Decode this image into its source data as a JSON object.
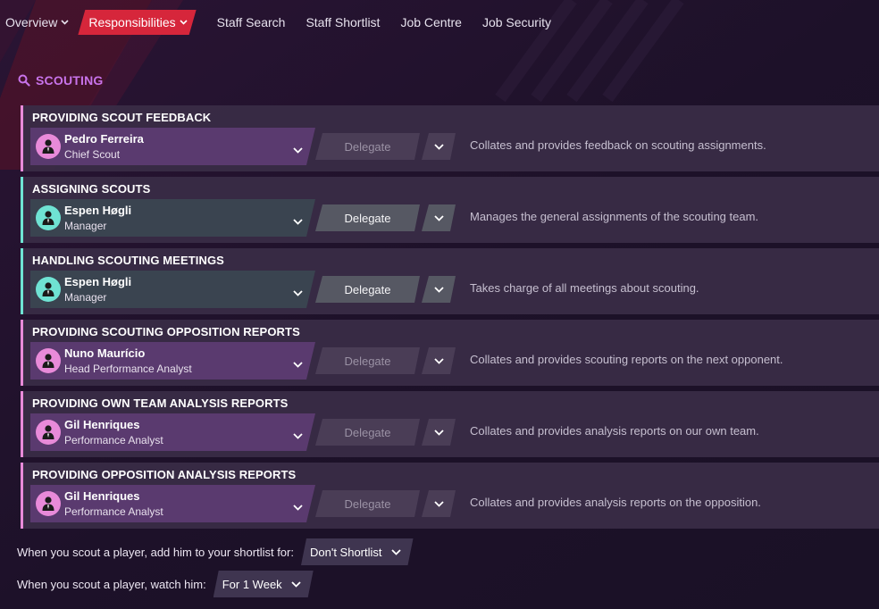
{
  "nav": {
    "items": [
      {
        "label": "Overview",
        "has_dropdown": true,
        "active": false
      },
      {
        "label": "Responsibilities",
        "has_dropdown": true,
        "active": true
      },
      {
        "label": "Staff Search",
        "has_dropdown": false,
        "active": false
      },
      {
        "label": "Staff Shortlist",
        "has_dropdown": false,
        "active": false
      },
      {
        "label": "Job Centre",
        "has_dropdown": false,
        "active": false
      },
      {
        "label": "Job Security",
        "has_dropdown": false,
        "active": false
      }
    ],
    "active_color": "#d6263b"
  },
  "section": {
    "title": "SCOUTING",
    "icon": "search-icon",
    "accent": "#c873ea"
  },
  "responsibilities": [
    {
      "title": "PROVIDING SCOUT FEEDBACK",
      "person_name": "Pedro Ferreira",
      "person_role": "Chief Scout",
      "delegate_label": "Delegate",
      "delegate_enabled": false,
      "description": "Collates and provides feedback on scouting assignments.",
      "accent": "pink"
    },
    {
      "title": "ASSIGNING SCOUTS",
      "person_name": "Espen Høgli",
      "person_role": "Manager",
      "delegate_label": "Delegate",
      "delegate_enabled": true,
      "description": "Manages the general assignments of the scouting team.",
      "accent": "teal"
    },
    {
      "title": "HANDLING SCOUTING MEETINGS",
      "person_name": "Espen Høgli",
      "person_role": "Manager",
      "delegate_label": "Delegate",
      "delegate_enabled": true,
      "description": "Takes charge of all meetings about scouting.",
      "accent": "teal"
    },
    {
      "title": "PROVIDING SCOUTING OPPOSITION REPORTS",
      "person_name": "Nuno Maurício",
      "person_role": "Head Performance Analyst",
      "delegate_label": "Delegate",
      "delegate_enabled": false,
      "description": "Collates and provides scouting reports on the next opponent.",
      "accent": "pink"
    },
    {
      "title": "PROVIDING OWN TEAM ANALYSIS REPORTS",
      "person_name": "Gil Henriques",
      "person_role": "Performance Analyst",
      "delegate_label": "Delegate",
      "delegate_enabled": false,
      "description": "Collates and provides analysis reports on our own team.",
      "accent": "pink"
    },
    {
      "title": "PROVIDING OPPOSITION ANALYSIS REPORTS",
      "person_name": "Gil Henriques",
      "person_role": "Performance Analyst",
      "delegate_label": "Delegate",
      "delegate_enabled": false,
      "description": "Collates and provides analysis reports on the opposition.",
      "accent": "pink"
    }
  ],
  "accent_colors": {
    "pink": "#e88ad9",
    "teal": "#6fe3d3"
  },
  "options": {
    "shortlist": {
      "label": "When you scout a player, add him to your shortlist for:",
      "value": "Don't Shortlist"
    },
    "watch": {
      "label": "When you scout a player, watch him:",
      "value": "For 1 Week"
    }
  }
}
